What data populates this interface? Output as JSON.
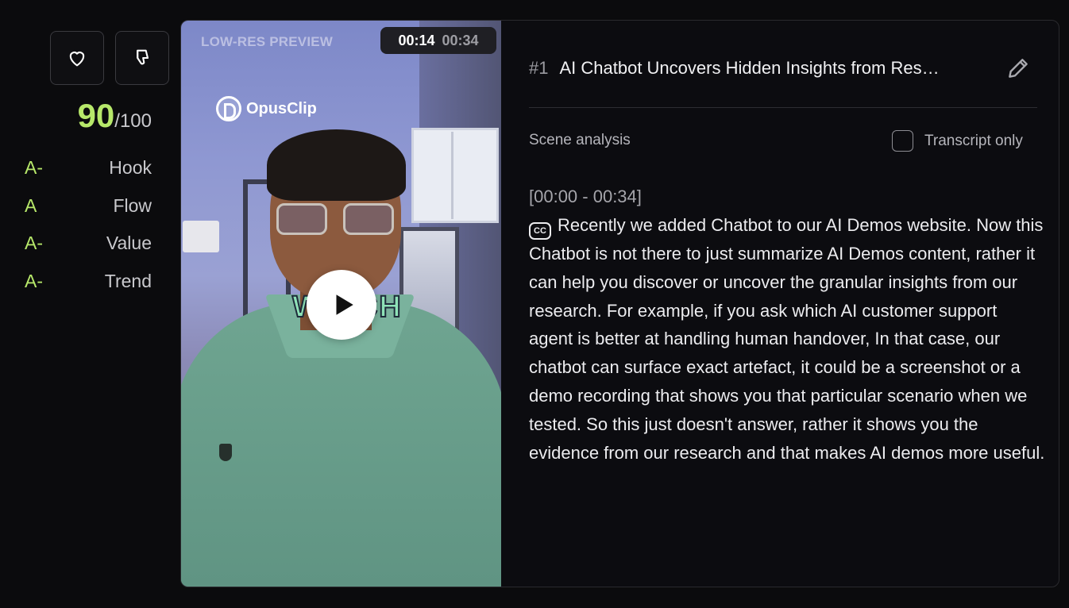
{
  "feedback": {
    "like_icon": "heart-icon",
    "dislike_icon": "thumbs-down-icon"
  },
  "score": {
    "value": "90",
    "max": "/100",
    "color": "#b7e86a"
  },
  "grades": [
    {
      "grade": "A-",
      "label": "Hook"
    },
    {
      "grade": "A",
      "label": "Flow"
    },
    {
      "grade": "A-",
      "label": "Value"
    },
    {
      "grade": "A-",
      "label": "Trend"
    }
  ],
  "video": {
    "preview_label": "LOW-RES PREVIEW",
    "time_current": "00:14",
    "time_total": "00:34",
    "brand": "OpusClip",
    "caption_word": "WHICH",
    "play_icon": "play-icon"
  },
  "clip": {
    "number": "#1",
    "title": "AI Chatbot Uncovers Hidden Insights from Res…",
    "edit_icon": "pencil-icon"
  },
  "analysis": {
    "scene_label": "Scene analysis",
    "transcript_only_label": "Transcript only",
    "transcript_only_checked": false,
    "segment_time": "[00:00 - 00:34]",
    "cc_icon": "CC",
    "transcript": "Recently we added Chatbot to our AI Demos website. Now this Chatbot is not there to just summarize AI Demos content, rather it can help you discover or uncover the granular insights from our research. For example, if you ask which AI customer support agent is better at handling human handover, In that case, our chatbot can surface exact artefact, it could be a screenshot or a demo recording that shows you that particular scenario when we tested. So this just doesn't answer, rather it shows you the evidence from our research and that makes AI demos more useful."
  }
}
